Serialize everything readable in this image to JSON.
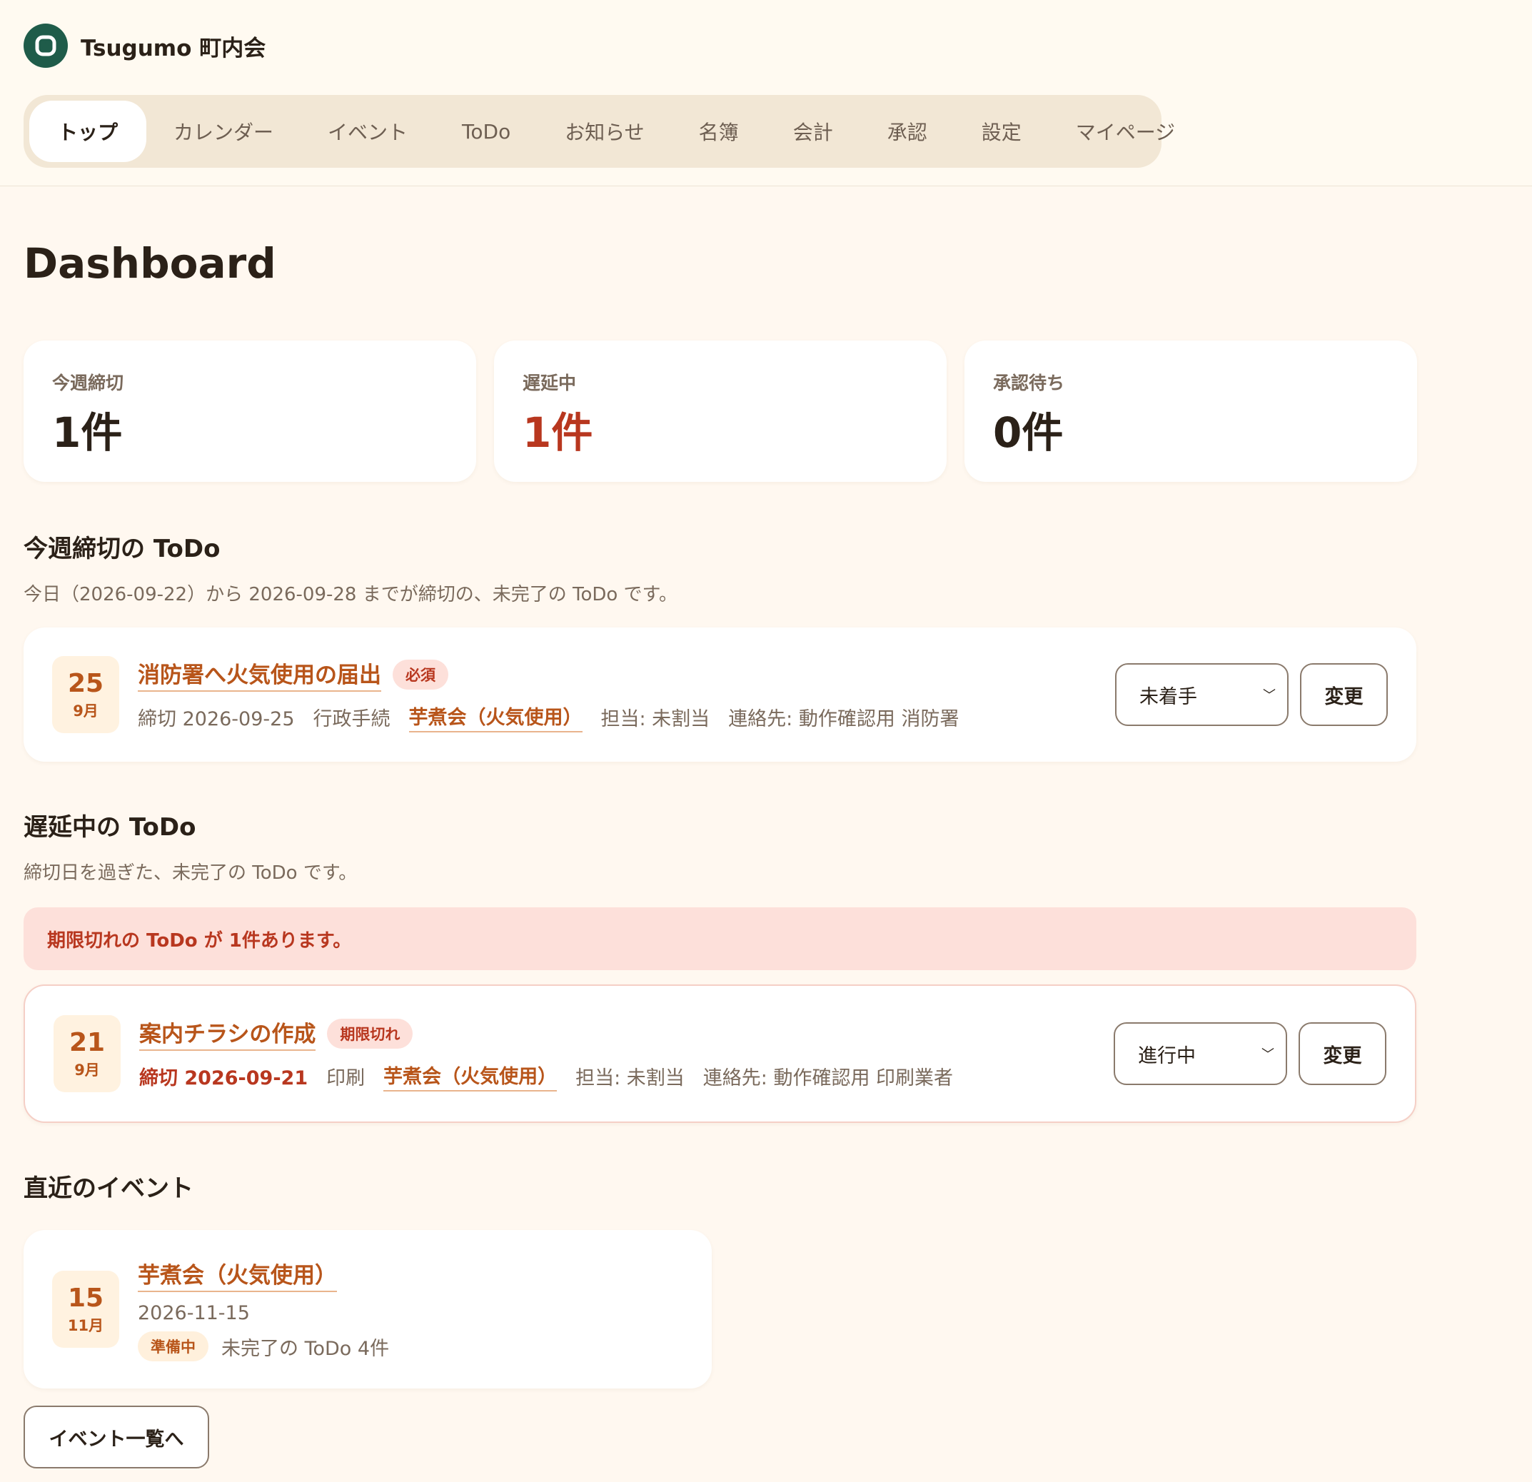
{
  "app": {
    "name": "Tsugumo 町内会"
  },
  "nav": {
    "items": [
      "トップ",
      "カレンダー",
      "イベント",
      "ToDo",
      "お知らせ",
      "名簿",
      "会計",
      "承認",
      "設定",
      "マイページ"
    ],
    "active_index": 0
  },
  "page": {
    "title": "Dashboard"
  },
  "stats": [
    {
      "label": "今週締切",
      "value": "1件"
    },
    {
      "label": "遅延中",
      "value": "1件"
    },
    {
      "label": "承認待ち",
      "value": "0件"
    }
  ],
  "this_week": {
    "title": "今週締切の ToDo",
    "description": "今日（2026-09-22）から 2026-09-28 までが締切の、未完了の ToDo です。",
    "items": [
      {
        "day": "25",
        "month": "9月",
        "title": "消防署へ火気使用の届出",
        "badge": "必須",
        "deadline": "締切 2026-09-25",
        "category": "行政手続",
        "event": "芋煮会（火気使用）",
        "assignee": "担当: 未割当",
        "contact": "連絡先: 動作確認用 消防署",
        "status": "未着手",
        "action": "変更"
      }
    ]
  },
  "overdue": {
    "title": "遅延中の ToDo",
    "description": "締切日を過ぎた、未完了の ToDo です。",
    "alert": "期限切れの ToDo が 1件あります。",
    "items": [
      {
        "day": "21",
        "month": "9月",
        "title": "案内チラシの作成",
        "badge": "期限切れ",
        "deadline": "締切 2026-09-21",
        "category": "印刷",
        "event": "芋煮会（火気使用）",
        "assignee": "担当: 未割当",
        "contact": "連絡先: 動作確認用 印刷業者",
        "status": "進行中",
        "action": "変更"
      }
    ]
  },
  "events": {
    "title": "直近のイベント",
    "items": [
      {
        "day": "15",
        "month": "11月",
        "title": "芋煮会（火気使用）",
        "date": "2026-11-15",
        "status": "準備中",
        "todo_count": "未完了の ToDo 4件"
      }
    ],
    "list_button": "イベント一覧へ"
  },
  "colors": {
    "background": "#fff8f0",
    "accent": "#b8551a",
    "danger": "#b8371f",
    "brand": "#1f5c4a"
  }
}
